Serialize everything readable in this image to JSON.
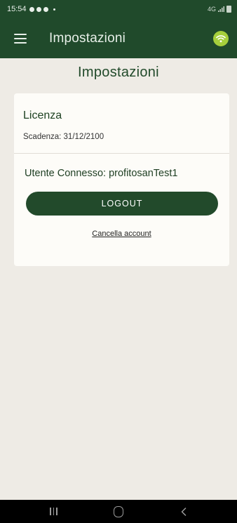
{
  "status_bar": {
    "time": "15:54",
    "right_indicator": "4G"
  },
  "app_bar": {
    "title": "Impostazioni",
    "menu_icon": "hamburger-menu-icon",
    "connection_icon": "wifi-icon",
    "connection_color": "#a6cf3c"
  },
  "page": {
    "title": "Impostazioni"
  },
  "license": {
    "title": "Licenza",
    "expiry": "Scadenza: 31/12/2100"
  },
  "account": {
    "user_label": "Utente Connesso: profitosanTest1",
    "logout_label": "LOGOUT",
    "delete_label": "Cancella account"
  },
  "colors": {
    "primary": "#204a2b",
    "background": "#eeebe5",
    "card": "#fdfcf8"
  }
}
